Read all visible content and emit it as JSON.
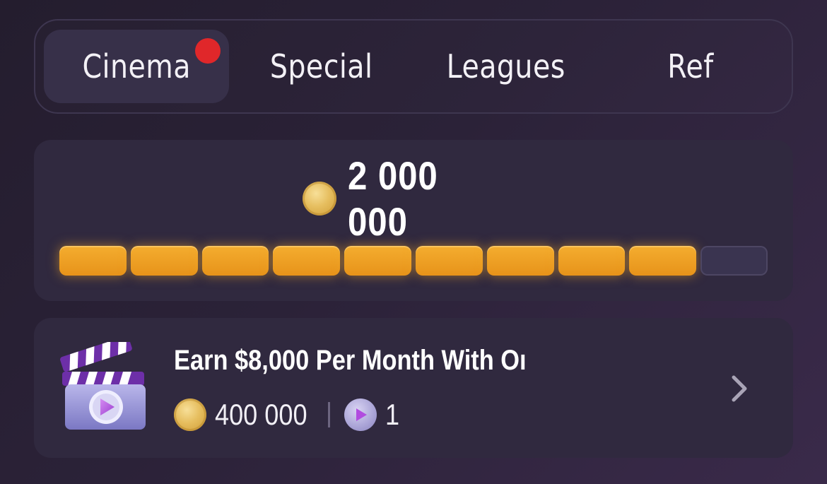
{
  "tabs": [
    {
      "label": "Cinema",
      "active": true,
      "has_badge": true
    },
    {
      "label": "Special",
      "active": false,
      "has_badge": false
    },
    {
      "label": "Leagues",
      "active": false,
      "has_badge": false
    },
    {
      "label": "Ref",
      "active": false,
      "has_badge": false
    }
  ],
  "progress": {
    "total_value": "2 000 000",
    "coin_icon": "coin-icon",
    "segments_total": 10,
    "segments_filled": 9
  },
  "task": {
    "icon": "clapperboard-icon",
    "title": "Earn $8,000 Per Month With Oı",
    "coin_reward": "400 000",
    "ticket_reward": "1",
    "coin_icon": "coin-icon",
    "ticket_icon": "play-token-icon",
    "chevron_icon": "chevron-right-icon"
  },
  "colors": {
    "accent_orange": "#f0a125",
    "badge_red": "#e0272a",
    "card_bg": "#30293f"
  }
}
